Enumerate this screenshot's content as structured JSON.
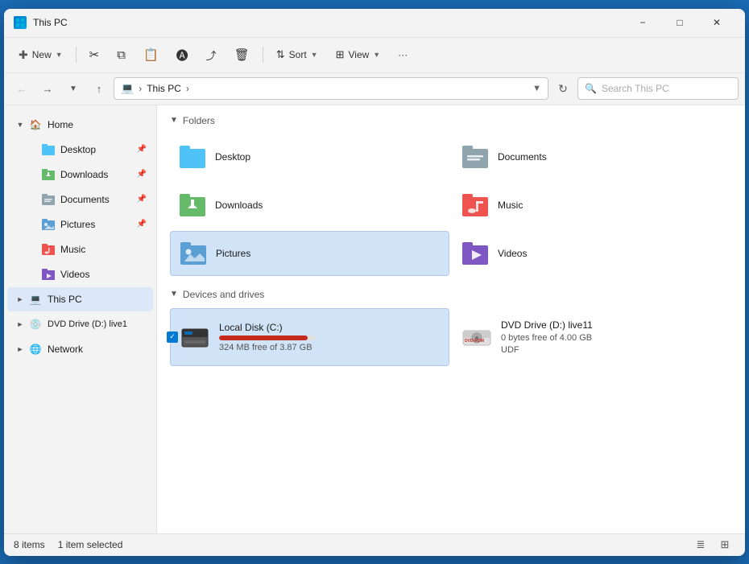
{
  "window": {
    "title": "This PC",
    "title_icon": "💻"
  },
  "toolbar": {
    "new_label": "New",
    "sort_label": "Sort",
    "view_label": "View",
    "more_label": "···"
  },
  "address_bar": {
    "path": "This PC",
    "search_placeholder": "Search This PC"
  },
  "sidebar": {
    "home_label": "Home",
    "items": [
      {
        "label": "Desktop",
        "icon": "desktop",
        "pinned": true
      },
      {
        "label": "Downloads",
        "icon": "downloads",
        "pinned": true
      },
      {
        "label": "Documents",
        "icon": "documents",
        "pinned": true
      },
      {
        "label": "Pictures",
        "icon": "pictures",
        "pinned": true
      },
      {
        "label": "Music",
        "icon": "music"
      },
      {
        "label": "Videos",
        "icon": "videos"
      }
    ],
    "this_pc_label": "This PC",
    "dvd_label": "DVD Drive (D:) live1",
    "network_label": "Network"
  },
  "folders_section": {
    "label": "Folders",
    "items": [
      {
        "name": "Desktop",
        "icon": "desktop"
      },
      {
        "name": "Documents",
        "icon": "documents"
      },
      {
        "name": "Downloads",
        "icon": "downloads"
      },
      {
        "name": "Music",
        "icon": "music"
      },
      {
        "name": "Pictures",
        "icon": "pictures"
      },
      {
        "name": "Videos",
        "icon": "videos"
      }
    ]
  },
  "devices_section": {
    "label": "Devices and drives",
    "items": [
      {
        "name": "Local Disk (C:)",
        "icon": "hdd",
        "meta": "324 MB free of 3.87 GB",
        "progress": 92,
        "selected": true
      },
      {
        "name": "DVD Drive (D:) live11",
        "icon": "dvd",
        "meta": "0 bytes free of 4.00 GB",
        "sub_meta": "UDF",
        "progress": null,
        "selected": false
      }
    ]
  },
  "status_bar": {
    "items_count": "8 items",
    "selection": "1 item selected"
  },
  "colors": {
    "accent": "#0078d4",
    "selected_bg": "#d0e3f7",
    "selected_border": "#b0c8e8",
    "progress_full": "#c42b1c"
  }
}
